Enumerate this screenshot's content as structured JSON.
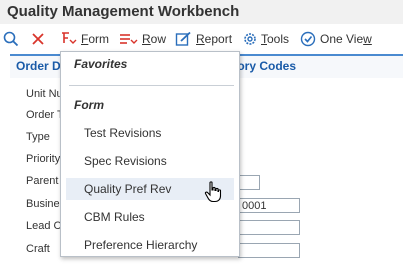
{
  "title": "Quality Management Workbench",
  "toolbar": {
    "form_label": "Form",
    "row_label": "Row",
    "report_label": "Report",
    "tools_label": "Tools",
    "oneview_label": "One View"
  },
  "tabs": {
    "first": "Order D",
    "second": "gory Codes"
  },
  "fields": [
    {
      "label": "Unit Nu"
    },
    {
      "label": "Order T"
    },
    {
      "label": "Type"
    },
    {
      "label": "Priority"
    },
    {
      "label": "Parent"
    },
    {
      "label": "Busine",
      "value": "0001"
    },
    {
      "label": "Lead C"
    },
    {
      "label": "Craft"
    }
  ],
  "menu": {
    "favorites_header": "Favorites",
    "form_header": "Form",
    "items": [
      "Test Revisions",
      "Spec Revisions",
      "Quality Pref Rev",
      "CBM Rules",
      "Preference Hierarchy"
    ],
    "hovered_item": "Quality Pref Rev"
  },
  "colors": {
    "accent": "#1a5ba8",
    "delete_red": "#d9342b",
    "icon_blue": "#2a6ebb"
  }
}
